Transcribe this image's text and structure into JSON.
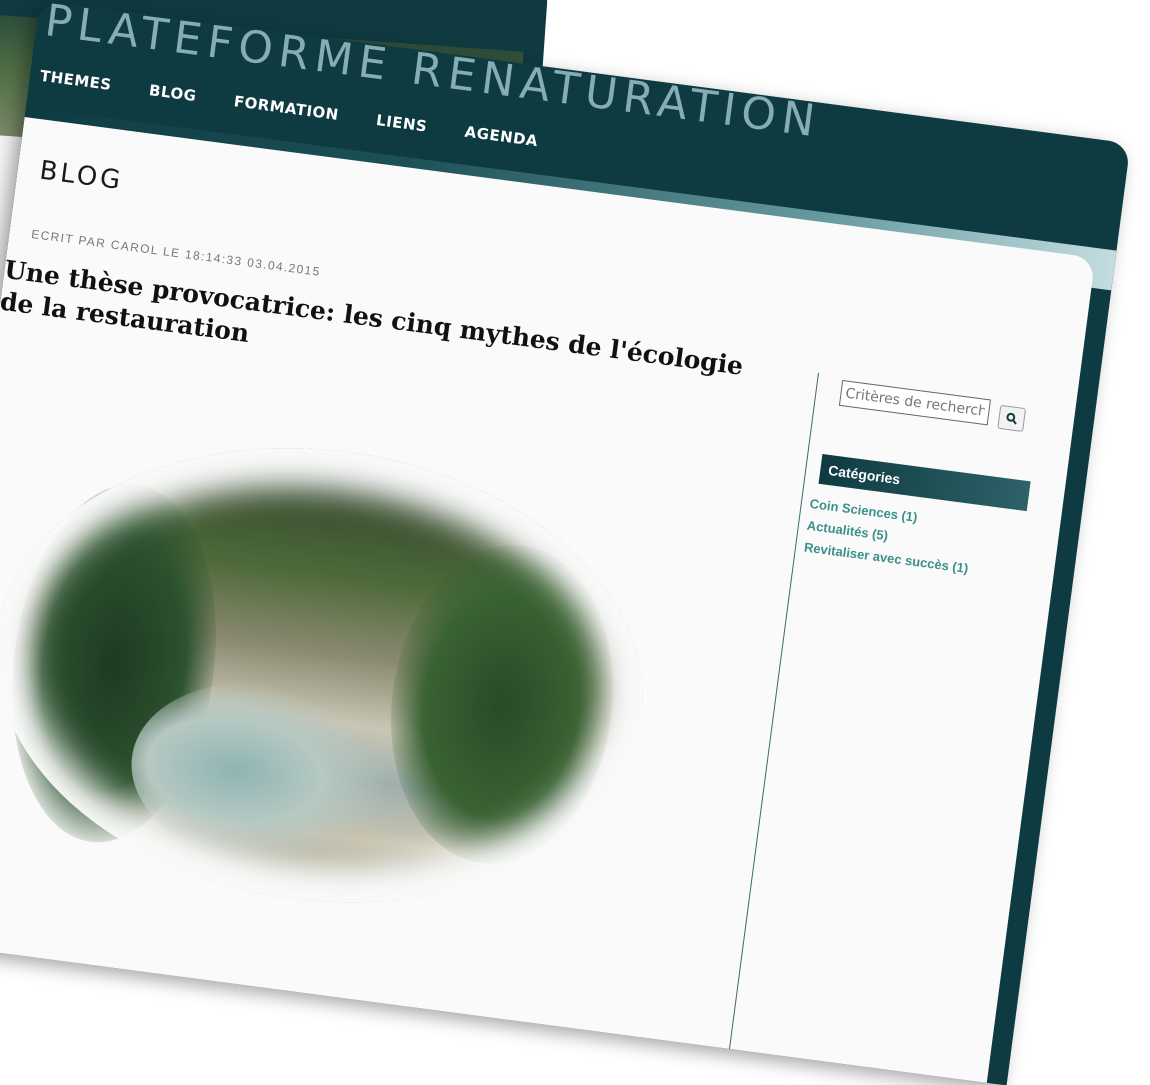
{
  "site": {
    "title": "PLATEFORME RENATURATION"
  },
  "nav": {
    "items": [
      "THEMES",
      "BLOG",
      "FORMATION",
      "LIENS",
      "AGENDA"
    ]
  },
  "page": {
    "heading": "BLOG"
  },
  "post": {
    "meta": "ECRIT PAR CAROL LE 18:14:33 03.04.2015",
    "title": "Une thèse provocatrice: les cinq mythes de l'écologie de la restauration"
  },
  "sidebar": {
    "search_placeholder": "Critères de recherche",
    "search_icon": "search-icon",
    "categories_title": "Catégories",
    "categories": [
      "Coin Sciences (1)",
      "Actualités (5)",
      "Revitaliser avec succès (1)"
    ]
  },
  "colors": {
    "header_bg": "#0e3b42",
    "content_bg": "#fafafa",
    "link": "#3d8f8a",
    "back_page_bar": "#2e9fe0"
  }
}
